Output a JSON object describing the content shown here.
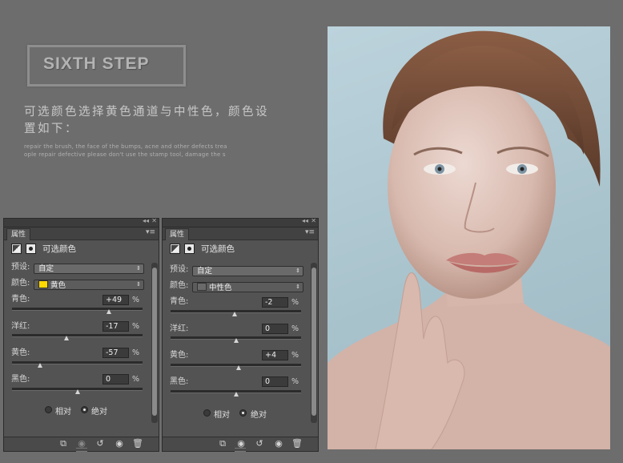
{
  "heading": {
    "step_title": "SIXTH STEP",
    "cn_description": "可选颜色选择黄色通道与中性色，颜色设置如下：",
    "en_line1": "repair the brush, the face of the bumps, acne and other defects trea",
    "en_line2": "ople repair defective please don't use the stamp tool, damage the s"
  },
  "panels": [
    {
      "tab": "属性",
      "title": "可选颜色",
      "preset_label": "预设:",
      "preset_value": "自定",
      "colors_label": "颜色:",
      "colors_value": "黄色",
      "swatch_color": "#ffd800",
      "sliders": [
        {
          "label": "青色:",
          "value": "+49",
          "unit": "%",
          "fraction": 0.745
        },
        {
          "label": "洋红:",
          "value": "-17",
          "unit": "%",
          "fraction": 0.415
        },
        {
          "label": "黄色:",
          "value": "-57",
          "unit": "%",
          "fraction": 0.215
        },
        {
          "label": "黑色:",
          "value": "0",
          "unit": "%",
          "fraction": 0.5
        }
      ],
      "radio_relative": "相对",
      "radio_absolute": "绝对",
      "selected_mode": "absolute"
    },
    {
      "tab": "属性",
      "title": "可选颜色",
      "preset_label": "预设:",
      "preset_value": "自定",
      "colors_label": "颜色:",
      "colors_value": "中性色",
      "swatch_color": "#6a6a6a",
      "sliders": [
        {
          "label": "青色:",
          "value": "-2",
          "unit": "%",
          "fraction": 0.49
        },
        {
          "label": "洋红:",
          "value": "0",
          "unit": "%",
          "fraction": 0.5
        },
        {
          "label": "黄色:",
          "value": "+4",
          "unit": "%",
          "fraction": 0.52
        },
        {
          "label": "黑色:",
          "value": "0",
          "unit": "%",
          "fraction": 0.5
        }
      ],
      "radio_relative": "相对",
      "radio_absolute": "绝对",
      "selected_mode": "absolute"
    }
  ],
  "icons": {
    "panel_header": [
      "adjustment-icon",
      "mask-icon"
    ],
    "bottom": [
      "clip-to-layer-icon",
      "view-previous-icon",
      "reset-icon",
      "visibility-eye-icon",
      "trash-icon"
    ]
  }
}
